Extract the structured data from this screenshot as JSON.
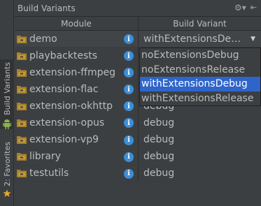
{
  "title": "Build Variants",
  "header": {
    "module": "Module",
    "variant": "Build Variant"
  },
  "stripe": {
    "build_variants": "Build Variants",
    "favorites": "2: Favorites"
  },
  "rows": [
    {
      "module": "demo",
      "variant": "withExtensionsDe…"
    },
    {
      "module": "playbacktests",
      "variant": ""
    },
    {
      "module": "extension-ffmpeg",
      "variant": ""
    },
    {
      "module": "extension-flac",
      "variant": ""
    },
    {
      "module": "extension-okhttp",
      "variant": "debug"
    },
    {
      "module": "extension-opus",
      "variant": "debug"
    },
    {
      "module": "extension-vp9",
      "variant": "debug"
    },
    {
      "module": "library",
      "variant": "debug"
    },
    {
      "module": "testutils",
      "variant": "debug"
    }
  ],
  "dropdown": {
    "options": [
      "noExtensionsDebug",
      "noExtensionsRelease",
      "withExtensionsDebug",
      "withExtensionsRelease"
    ],
    "highlighted": "withExtensionsDebug"
  },
  "colors": {
    "background": "#3c3f41",
    "highlight": "#2f65ca",
    "info": "#3d8ed6",
    "folder": "#a9822c",
    "android": "#8cb34b",
    "star": "#e5a52b"
  },
  "icons": {
    "settings": "gear-icon",
    "hide": "hide-icon",
    "info": "info-icon",
    "module": "module-folder-icon",
    "android": "android-icon",
    "favorites": "star-icon"
  }
}
